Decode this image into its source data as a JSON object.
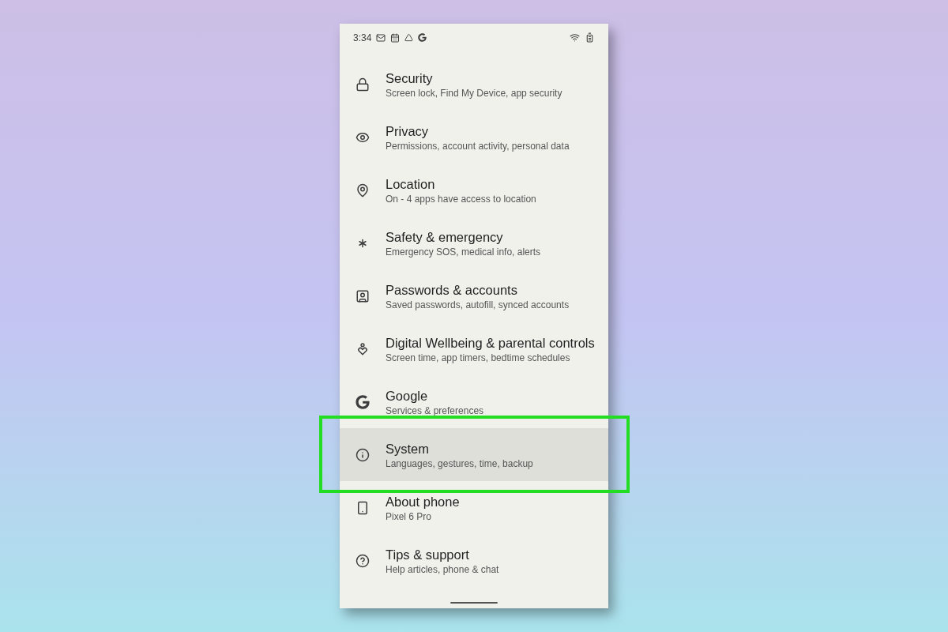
{
  "status_bar": {
    "time": "3:34"
  },
  "settings": [
    {
      "title": "Security",
      "subtitle": "Screen lock, Find My Device, app security",
      "selected": false
    },
    {
      "title": "Privacy",
      "subtitle": "Permissions, account activity, personal data",
      "selected": false
    },
    {
      "title": "Location",
      "subtitle": "On - 4 apps have access to location",
      "selected": false
    },
    {
      "title": "Safety & emergency",
      "subtitle": "Emergency SOS, medical info, alerts",
      "selected": false
    },
    {
      "title": "Passwords & accounts",
      "subtitle": "Saved passwords, autofill, synced accounts",
      "selected": false
    },
    {
      "title": "Digital Wellbeing & parental controls",
      "subtitle": "Screen time, app timers, bedtime schedules",
      "selected": false
    },
    {
      "title": "Google",
      "subtitle": "Services & preferences",
      "selected": false
    },
    {
      "title": "System",
      "subtitle": "Languages, gestures, time, backup",
      "selected": true
    },
    {
      "title": "About phone",
      "subtitle": "Pixel 6 Pro",
      "selected": false
    },
    {
      "title": "Tips & support",
      "subtitle": "Help articles, phone & chat",
      "selected": false
    }
  ]
}
